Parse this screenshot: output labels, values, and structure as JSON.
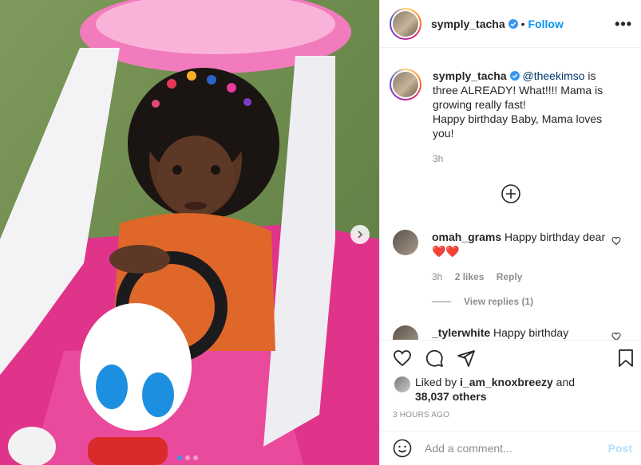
{
  "post": {
    "username": "symply_tacha",
    "follow_label": "Follow",
    "separator": "•",
    "more_label": "•••"
  },
  "caption": {
    "username": "symply_tacha",
    "mention": "@theekimso",
    "text": " is three ALREADY! What!!!! Mama is growing really fast!",
    "text2": "Happy birthday Baby, Mama loves you!",
    "time": "3h"
  },
  "comments": [
    {
      "username": "omah_grams",
      "text": " Happy birthday dear❤️❤️",
      "time": "3h",
      "likes": "2 likes",
      "reply_label": "Reply",
      "view_replies": "View replies (1)"
    },
    {
      "username": "_tylerwhite",
      "text": " Happy birthday"
    }
  ],
  "likes": {
    "prefix": "Liked by ",
    "user": "i_am_knoxbreezy",
    "and": " and",
    "others": "38,037 others"
  },
  "timestamp": "3 HOURS AGO",
  "composer": {
    "placeholder": "Add a comment...",
    "post_label": "Post"
  },
  "colors": {
    "accent": "#0095f6",
    "verified": "#3897f0",
    "muted": "#8e8e8e",
    "post_disabled": "#b2dffc"
  },
  "icons": [
    "chevron-right-icon",
    "verified-badge-icon",
    "more-icon",
    "plus-circle-icon",
    "heart-icon",
    "comment-icon",
    "share-icon",
    "bookmark-icon",
    "emoji-icon"
  ]
}
